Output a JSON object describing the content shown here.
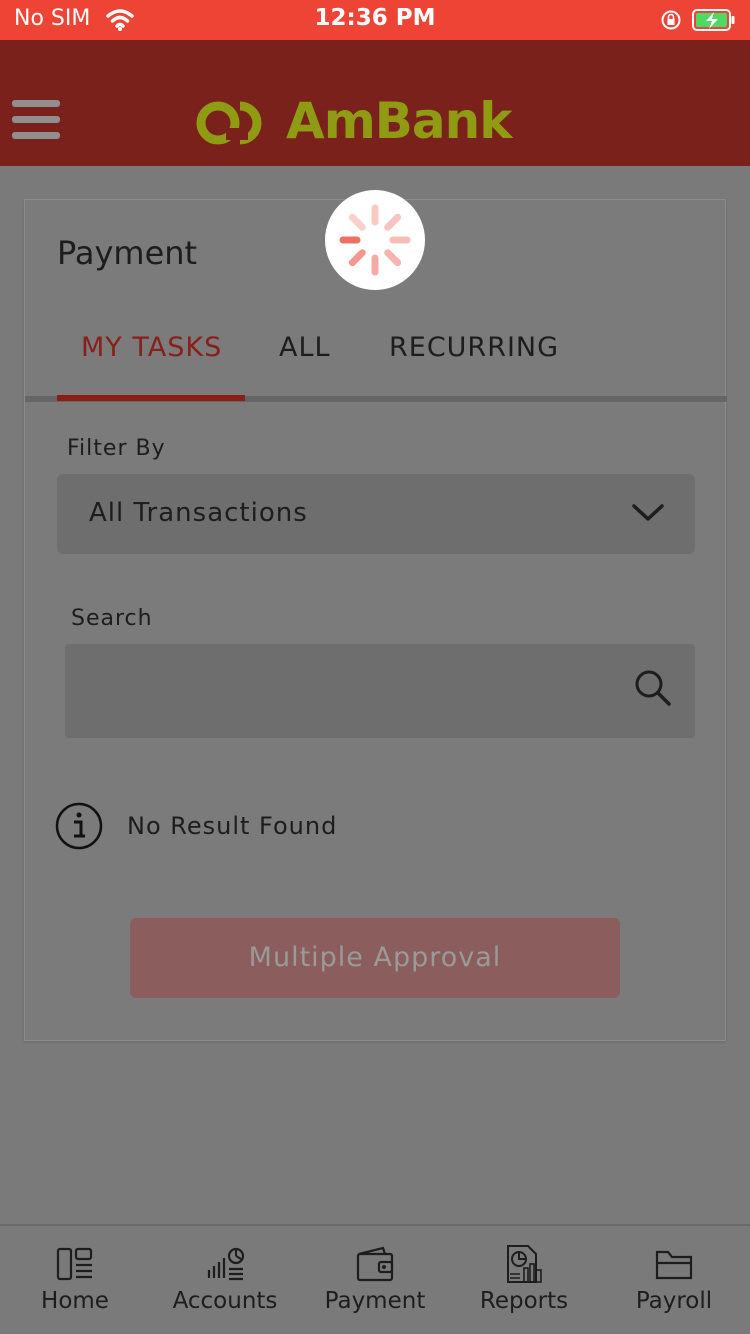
{
  "status_bar": {
    "carrier": "No SIM",
    "time": "12:36 PM"
  },
  "header": {
    "menu_icon": "hamburger-icon",
    "logo_text": "AmBank",
    "logo_color": "#8f9b13",
    "bar_color": "#7a211b"
  },
  "card": {
    "title": "Payment",
    "tabs": [
      {
        "label": "MY TASKS",
        "active": true
      },
      {
        "label": "ALL",
        "active": false
      },
      {
        "label": "RECURRING",
        "active": false
      }
    ],
    "filter": {
      "label": "Filter By",
      "value": "All Transactions"
    },
    "search": {
      "label": "Search",
      "value": ""
    },
    "empty_message": "No Result Found",
    "multiple_approval_label": "Multiple Approval"
  },
  "loading": true,
  "bottom_nav": [
    {
      "label": "Home",
      "icon": "home-icon"
    },
    {
      "label": "Accounts",
      "icon": "accounts-icon"
    },
    {
      "label": "Payment",
      "icon": "wallet-icon"
    },
    {
      "label": "Reports",
      "icon": "reports-icon"
    },
    {
      "label": "Payroll",
      "icon": "folder-icon"
    }
  ],
  "colors": {
    "status_bar": "#ee4436",
    "accent": "#8a1e19",
    "overlay": "#7a7a7a"
  }
}
